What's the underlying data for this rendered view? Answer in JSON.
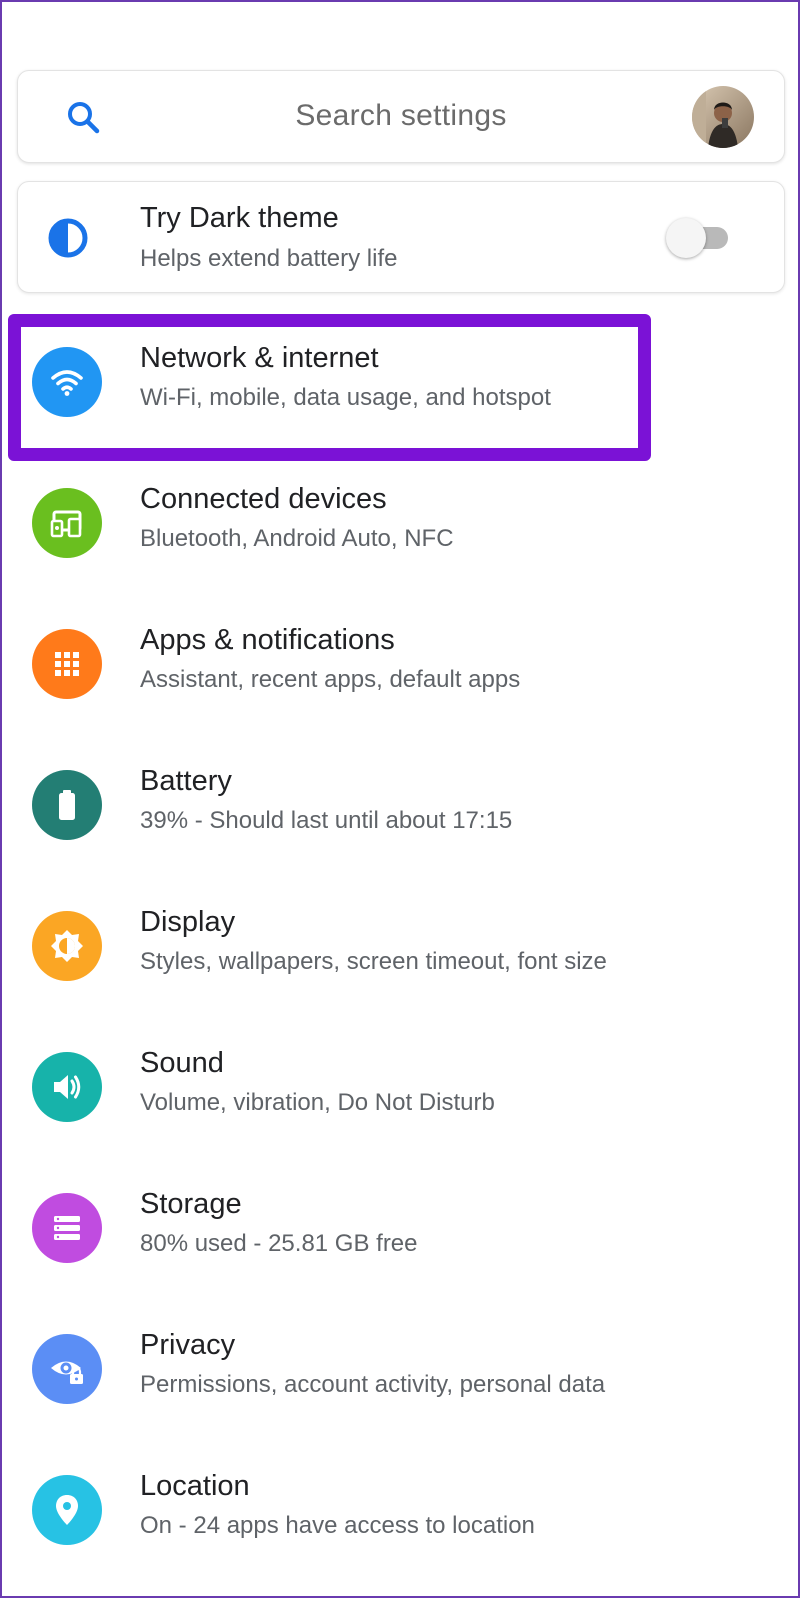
{
  "search": {
    "placeholder": "Search settings",
    "icon": "search-icon",
    "accent": "#1a73e8"
  },
  "dark_theme": {
    "title": "Try Dark theme",
    "subtitle": "Helps extend battery life",
    "icon": "half-circle-icon",
    "toggle_on": false
  },
  "highlight_color": "#7b12d6",
  "items": [
    {
      "title": "Network & internet",
      "subtitle": "Wi-Fi, mobile, data usage, and hotspot",
      "icon": "wifi-icon",
      "color": "#2196f3"
    },
    {
      "title": "Connected devices",
      "subtitle": "Bluetooth, Android Auto, NFC",
      "icon": "devices-icon",
      "color": "#6abf1f"
    },
    {
      "title": "Apps & notifications",
      "subtitle": "Assistant, recent apps, default apps",
      "icon": "apps-grid-icon",
      "color": "#ff7a1a"
    },
    {
      "title": "Battery",
      "subtitle": "39% - Should last until about 17:15",
      "icon": "battery-icon",
      "color": "#237e74"
    },
    {
      "title": "Display",
      "subtitle": "Styles, wallpapers, screen timeout, font size",
      "icon": "brightness-icon",
      "color": "#fba624"
    },
    {
      "title": "Sound",
      "subtitle": "Volume, vibration, Do Not Disturb",
      "icon": "speaker-icon",
      "color": "#17b3aa"
    },
    {
      "title": "Storage",
      "subtitle": "80% used - 25.81 GB free",
      "icon": "storage-icon",
      "color": "#c04ce0"
    },
    {
      "title": "Privacy",
      "subtitle": "Permissions, account activity, personal data",
      "icon": "privacy-eye-icon",
      "color": "#5b8ef5"
    },
    {
      "title": "Location",
      "subtitle": "On - 24 apps have access to location",
      "icon": "location-pin-icon",
      "color": "#27c2e4"
    }
  ]
}
